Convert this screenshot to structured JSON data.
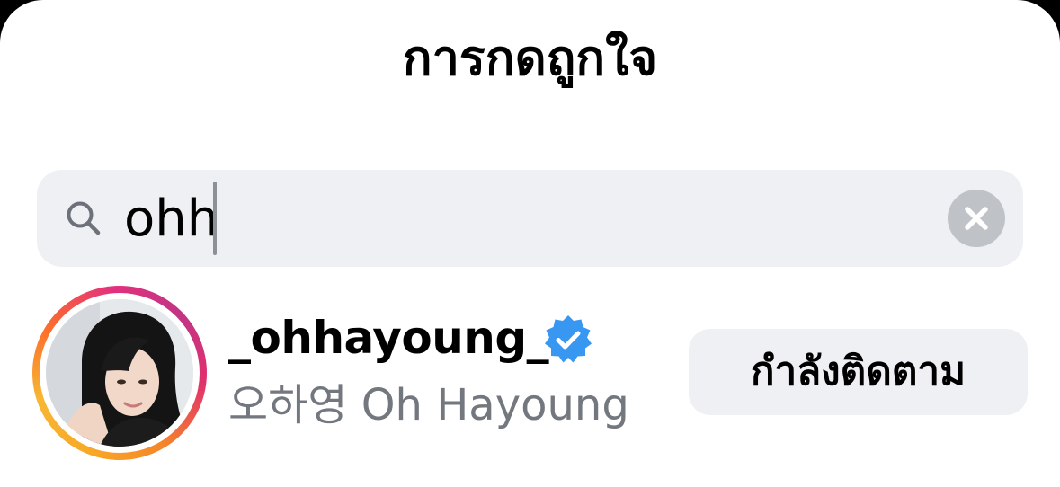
{
  "header": {
    "title": "การกดถูกใจ"
  },
  "search": {
    "value": "ohh",
    "icon": "search-icon",
    "clear_icon": "close-icon"
  },
  "results": [
    {
      "username": "_ohhayoung_",
      "verified": true,
      "full_name": "오하영 Oh Hayoung",
      "follow_label": "กำลังติดตาม",
      "has_story_ring": true
    }
  ],
  "colors": {
    "verified_badge": "#3897f0",
    "search_bg": "#eff0f4",
    "button_bg": "#eff0f4",
    "secondary_text": "#73777e"
  }
}
